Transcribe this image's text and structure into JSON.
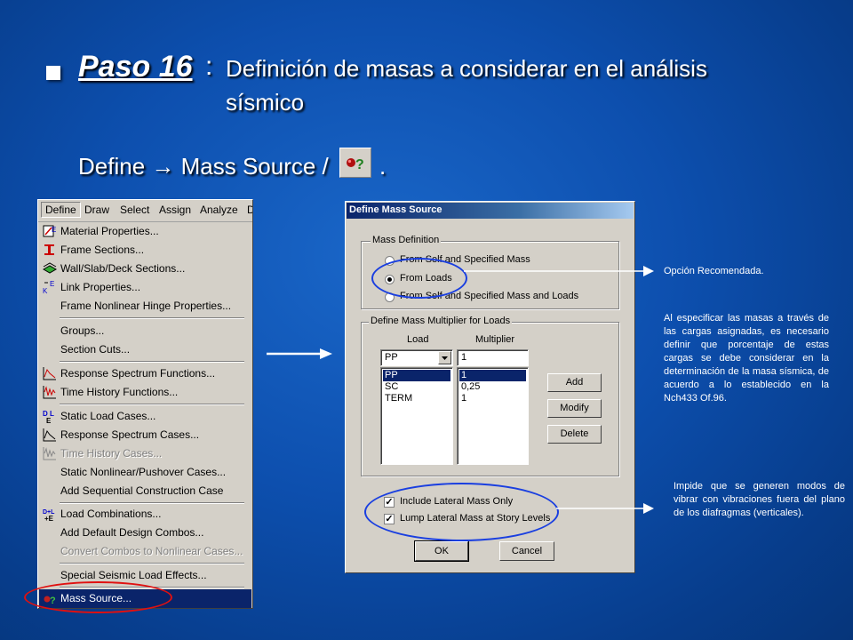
{
  "title": {
    "step": "Paso 16",
    "colon": ":",
    "line1": "Definición de masas a considerar en el análisis",
    "line2": "sísmico"
  },
  "menu_path": {
    "text": "Define → Mass Source /",
    "suffix": "."
  },
  "menu": {
    "bar": [
      "Define",
      "Draw",
      "Select",
      "Assign",
      "Analyze",
      "D"
    ],
    "items": [
      {
        "label": "Material Properties...",
        "icon": "material-icon"
      },
      {
        "label": "Frame Sections...",
        "icon": "frame-section-icon"
      },
      {
        "label": "Wall/Slab/Deck Sections...",
        "icon": "wall-slab-icon"
      },
      {
        "label": "Link Properties...",
        "icon": "link-icon"
      },
      {
        "label": "Frame Nonlinear Hinge Properties...",
        "icon": ""
      },
      {
        "label": "Groups...",
        "icon": ""
      },
      {
        "label": "Section Cuts...",
        "icon": ""
      },
      {
        "label": "Response Spectrum Functions...",
        "icon": "response-spectrum-icon"
      },
      {
        "label": "Time History Functions...",
        "icon": "time-history-icon"
      },
      {
        "label": "Static Load Cases...",
        "icon": "static-load-icon"
      },
      {
        "label": "Response Spectrum Cases...",
        "icon": "response-spectrum-case-icon"
      },
      {
        "label": "Time History Cases...",
        "icon": "time-history-case-icon"
      },
      {
        "label": "Static Nonlinear/Pushover Cases...",
        "icon": ""
      },
      {
        "label": "Add Sequential Construction Case",
        "icon": ""
      },
      {
        "label": "Load Combinations...",
        "icon": "load-combination-icon"
      },
      {
        "label": "Add Default Design Combos...",
        "icon": ""
      },
      {
        "label": "Convert Combos to Nonlinear Cases...",
        "icon": ""
      },
      {
        "label": "Special Seismic Load Effects...",
        "icon": ""
      },
      {
        "label": "Mass Source...",
        "icon": "mass-source-icon"
      }
    ]
  },
  "dialog": {
    "title": "Define Mass Source",
    "mass_definition": {
      "label": "Mass Definition",
      "options": [
        "From Self and Specified Mass",
        "From Loads",
        "From Self and Specified Mass and Loads"
      ],
      "selected": "From Loads"
    },
    "multiplier": {
      "label": "Define Mass Multiplier for Loads",
      "col_load": "Load",
      "col_multiplier": "Multiplier",
      "load_value": "PP",
      "multiplier_value": "1",
      "loads": [
        "PP",
        "SC",
        "TERM"
      ],
      "multipliers": [
        "1",
        "0,25",
        "1"
      ],
      "buttons": {
        "add": "Add",
        "modify": "Modify",
        "delete": "Delete"
      }
    },
    "checks": {
      "lateral_only": "Include Lateral Mass Only",
      "lump": "Lump Lateral Mass at Story Levels"
    },
    "ok": "OK",
    "cancel": "Cancel"
  },
  "notes": {
    "recommended": "Opción Recomendada.",
    "loads_explanation": "Al especificar las masas a través de las cargas asignadas, es necesario definir que porcentaje de estas cargas se debe considerar en la determinación de la masa sísmica, de acuerdo a lo establecido en la Nch433 Of.96.",
    "lateral_explanation": "Impide que se generen modos de vibrar con vibraciones fuera del plano de los diafragmas (verticales)."
  },
  "colors": {
    "background": "#0d4fae",
    "highlight_ellipse_blue": "#1a3fe0",
    "highlight_ellipse_red": "#e01010",
    "selection": "#0a246a"
  }
}
